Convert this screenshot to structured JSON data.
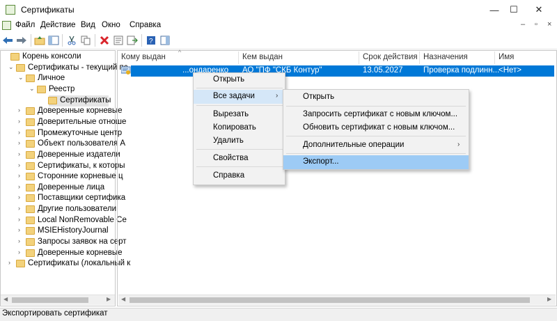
{
  "window": {
    "title": "Сертификаты",
    "minimize_icon": "—",
    "maximize_icon": "☐",
    "close_icon": "✕"
  },
  "menubar": {
    "items": [
      "Файл",
      "Действие",
      "Вид",
      "Окно",
      "Справка"
    ],
    "mdi_minimize": "–",
    "mdi_restore": "▫",
    "mdi_close": "×"
  },
  "toolbar": {
    "buttons": [
      "back-arrow-icon",
      "forward-arrow-icon",
      "up-folder-icon",
      "show-hide-tree-icon",
      "cut-icon",
      "copy-icon",
      "delete-icon",
      "properties-icon",
      "export-list-icon",
      "help-icon",
      "action-pane-icon"
    ]
  },
  "tree": {
    "items": [
      {
        "label": "Корень консоли",
        "level": 0,
        "arrow": ""
      },
      {
        "label": "Сертификаты - текущий пс",
        "level": 1,
        "arrow": "⌄"
      },
      {
        "label": "Личное",
        "level": 2,
        "arrow": "⌄"
      },
      {
        "label": "Реестр",
        "level": 3,
        "arrow": "⌄"
      },
      {
        "label": "Сертификаты",
        "level": 4,
        "arrow": "",
        "selected": true
      },
      {
        "label": "Доверенные корневые",
        "level": 2,
        "arrow": "›"
      },
      {
        "label": "Доверительные отноше",
        "level": 2,
        "arrow": "›"
      },
      {
        "label": "Промежуточные центр",
        "level": 2,
        "arrow": "›"
      },
      {
        "label": "Объект пользователя А",
        "level": 2,
        "arrow": "›"
      },
      {
        "label": "Доверенные издатели",
        "level": 2,
        "arrow": "›"
      },
      {
        "label": "Сертификаты, к которы",
        "level": 2,
        "arrow": "›"
      },
      {
        "label": "Сторонние корневые ц",
        "level": 2,
        "arrow": "›"
      },
      {
        "label": "Доверенные лица",
        "level": 2,
        "arrow": "›"
      },
      {
        "label": "Поставщики сертифика",
        "level": 2,
        "arrow": "›"
      },
      {
        "label": "Другие пользователи",
        "level": 2,
        "arrow": "›"
      },
      {
        "label": "Local NonRemovable Ce",
        "level": 2,
        "arrow": "›"
      },
      {
        "label": "MSIEHistoryJournal",
        "level": 2,
        "arrow": "›"
      },
      {
        "label": "Запросы заявок на серт",
        "level": 2,
        "arrow": "›"
      },
      {
        "label": "Доверенные корневые",
        "level": 2,
        "arrow": "›"
      },
      {
        "label": "Сертификаты (локальный к",
        "level": 1,
        "arrow": "›"
      }
    ]
  },
  "list": {
    "columns": [
      "Кому выдан",
      "Кем выдан",
      "Срок действия",
      "Назначения",
      "Имя"
    ],
    "sort_indicator": "^",
    "rows": [
      {
        "issued_to": "...ондаренко",
        "issued_by": "АО \"ПФ \"СКБ Контур\"",
        "expires": "13.05.2027",
        "purposes": "Проверка подлинн...",
        "name": "<Нет>"
      }
    ]
  },
  "context_menu": {
    "items": [
      "Открыть",
      "Все задачи",
      "Вырезать",
      "Копировать",
      "Удалить",
      "Свойства",
      "Справка"
    ],
    "submenu_arrow": "›"
  },
  "submenu": {
    "items": [
      "Открыть",
      "Запросить сертификат с новым ключом...",
      "Обновить сертификат с новым ключом...",
      "Дополнительные операции",
      "Экспорт..."
    ],
    "submenu_arrow": "›"
  },
  "status": {
    "text": "Экспортировать сертификат"
  },
  "colors": {
    "selection": "#0078d7",
    "menu_highlight": "#d5e7f8",
    "submenu_highlight": "#9dcbf5"
  }
}
